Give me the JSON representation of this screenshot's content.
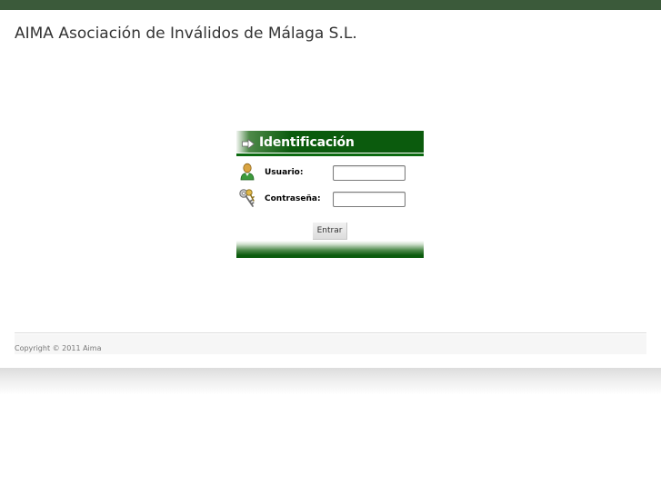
{
  "header": {
    "site_title": "AIMA Asociación de Inválidos de Málaga S.L."
  },
  "login": {
    "title": "Identificación",
    "username_label": "Usuario:",
    "username_value": "",
    "password_label": "Contraseña:",
    "password_value": "",
    "submit_label": "Entrar"
  },
  "footer": {
    "copyright": "Copyright © 2011 Aima"
  },
  "colors": {
    "top_strip": "#3b5a3a",
    "brand_green": "#0b5b0d",
    "title_text": "#333333",
    "footer_text": "#777777"
  },
  "icons": {
    "header_arrow": "arrow-right-icon",
    "username": "user-icon",
    "password": "keys-icon"
  }
}
